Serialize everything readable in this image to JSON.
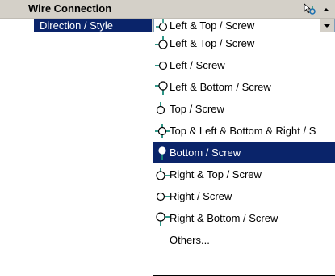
{
  "header": {
    "title": "Wire Connection",
    "icon": "property-edit-icon",
    "collapse_icon": "collapse-up-icon"
  },
  "property": {
    "label": "Direction / Style",
    "value": "Left & Top / Screw",
    "value_icon": "wire-left-top-icon"
  },
  "dropdown": {
    "options": [
      {
        "label": "Left & Top / Screw",
        "icon": "wire-left-top-icon"
      },
      {
        "label": "Left / Screw",
        "icon": "wire-left-icon"
      },
      {
        "label": "Left & Bottom / Screw",
        "icon": "wire-left-bottom-icon"
      },
      {
        "label": "Top / Screw",
        "icon": "wire-top-icon"
      },
      {
        "label": "Top & Left & Bottom & Right / S",
        "icon": "wire-all-icon"
      },
      {
        "label": "Bottom / Screw",
        "icon": "wire-bottom-icon",
        "selected": true
      },
      {
        "label": "Right & Top / Screw",
        "icon": "wire-right-top-icon"
      },
      {
        "label": "Right / Screw",
        "icon": "wire-right-icon"
      },
      {
        "label": "Right & Bottom / Screw",
        "icon": "wire-right-bottom-icon"
      },
      {
        "label": "Others...",
        "icon": ""
      }
    ]
  },
  "colors": {
    "selection": "#0a246a",
    "header_bg": "#d4d0c8",
    "wire_teal": "#1a8a7a"
  }
}
